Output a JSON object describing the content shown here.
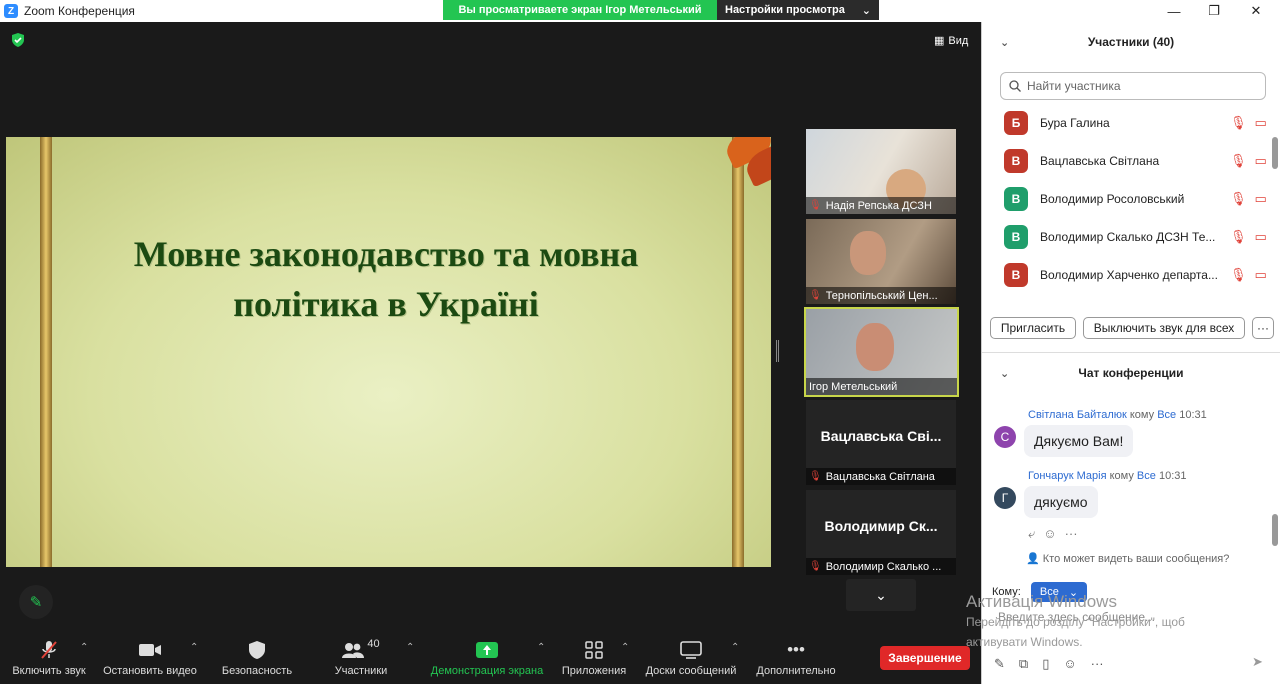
{
  "window": {
    "title": "Zoom Конференция",
    "logo": "Z",
    "minimize_icon": "—",
    "maximize_icon": "❐",
    "close_icon": "✕"
  },
  "share_banner": {
    "viewing_text": "Вы просматриваете экран Ігор Метельський",
    "view_settings_label": "Настройки просмотра",
    "chevron": "⌄"
  },
  "stage": {
    "view_label": "Вид",
    "view_icon": "▦"
  },
  "slide": {
    "title_line1": "Мовне законодавство та мовна",
    "title_line2": "політика в Україні"
  },
  "tiles": [
    {
      "name": "Надія Репська ДСЗН",
      "muted": true
    },
    {
      "name": "Тернопільський Цен...",
      "muted": true
    },
    {
      "name": "Ігор Метельський",
      "muted": false
    },
    {
      "big": "Вацлавська  Сві...",
      "name": "Вацлавська Світлана",
      "muted": true
    },
    {
      "big": "Володимир  Ск...",
      "name": "Володимир Скалько ...",
      "muted": true
    }
  ],
  "toolbar": {
    "unmute": "Включить звук",
    "stop_video": "Остановить видео",
    "security": "Безопасность",
    "participants": "Участники",
    "participants_count": "40",
    "share_screen": "Демонстрация экрана",
    "apps": "Приложения",
    "whiteboards": "Доски сообщений",
    "more": "Дополнительно",
    "end": "Завершение"
  },
  "participants": {
    "header": "Участники (40)",
    "search_placeholder": "Найти участника",
    "list": [
      {
        "initial": "Б",
        "name": "Бура Галина",
        "color": "#c0392b"
      },
      {
        "initial": "В",
        "name": "Вацлавська Світлана",
        "color": "#c0392b"
      },
      {
        "initial": "В",
        "name": "Володимир Росоловський",
        "color": "#1f9e6b"
      },
      {
        "initial": "В",
        "name": "Володимир Скалько ДСЗН Те...",
        "color": "#1f9e6b"
      },
      {
        "initial": "В",
        "name": "Володимир Харченко департа...",
        "color": "#c0392b"
      }
    ],
    "invite": "Пригласить",
    "mute_all": "Выключить звук для всех",
    "more": "···"
  },
  "chat": {
    "header": "Чат конференции",
    "messages": [
      {
        "initial": "С",
        "color": "#8e44ad",
        "sender": "Світлана Байталюк",
        "to_word": "кому",
        "to": "Все",
        "time": "10:31",
        "text": "Дякуємо Вам!"
      },
      {
        "initial": "Г",
        "color": "#34495e",
        "sender": "Гончарук Марія",
        "to_word": "кому",
        "to": "Все",
        "time": "10:31",
        "text": "дякуємо"
      }
    ],
    "who_can_see": "Кто может видеть ваши сообщения?",
    "to_label": "Кому:",
    "to_value": "Все",
    "input_placeholder": "Введите здесь сообщение..."
  },
  "watermark": {
    "line1": "Активація Windows",
    "line2": "Перейдіть до розділу \"Настройки\", щоб",
    "line3": "активувати Windows."
  }
}
